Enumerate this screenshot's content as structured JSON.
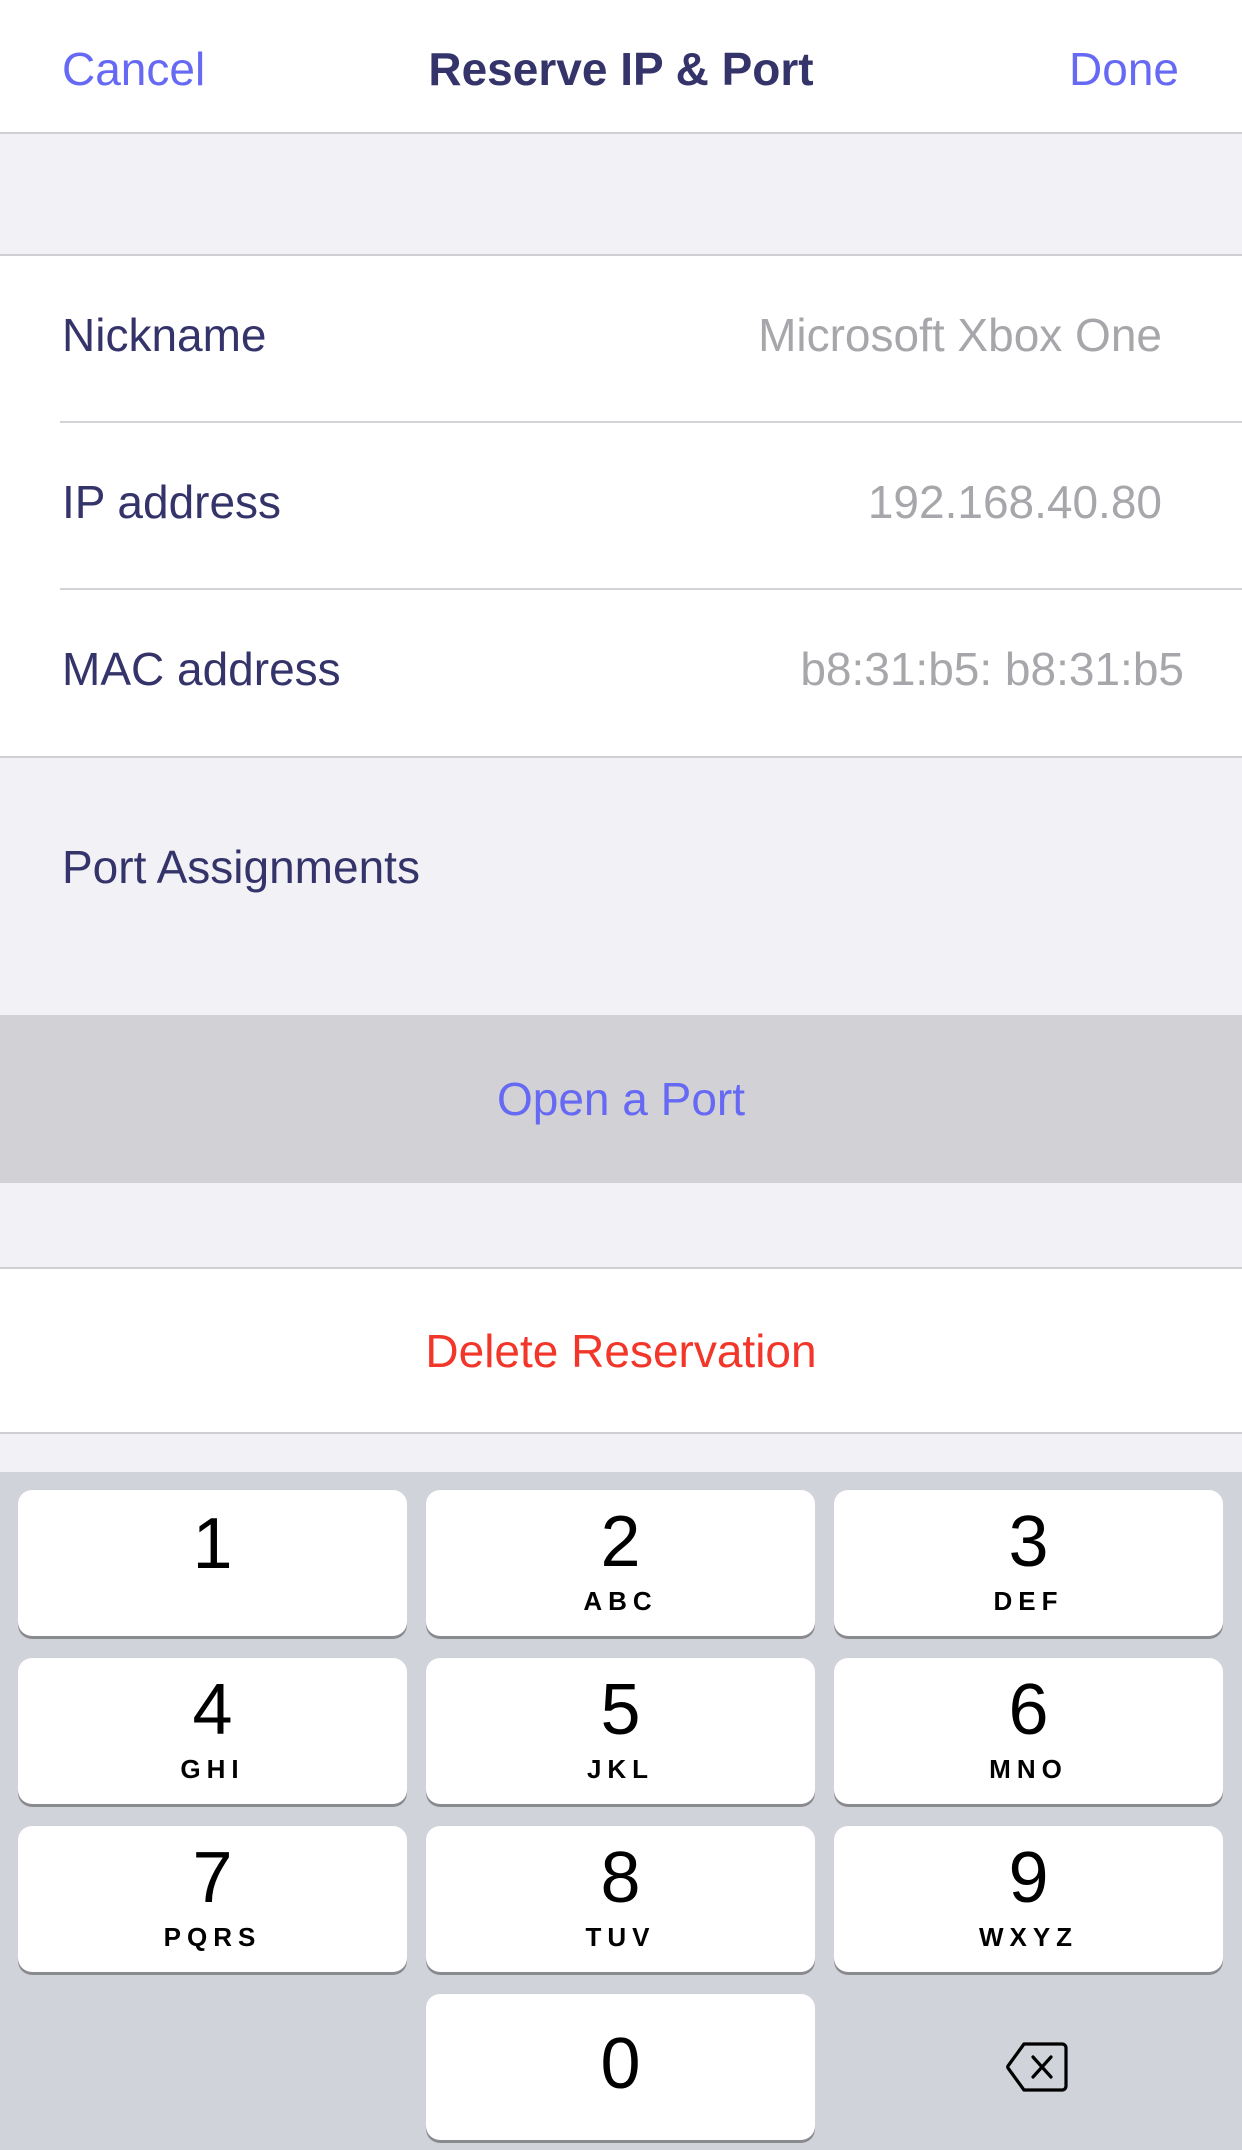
{
  "theme": {
    "accent": "#6669F3",
    "navy": "#35346A",
    "danger": "#F2362A"
  },
  "nav": {
    "cancel_label": "Cancel",
    "title": "Reserve IP & Port",
    "done_label": "Done"
  },
  "fields": {
    "nickname": {
      "label": "Nickname",
      "value": "Microsoft Xbox One"
    },
    "ip": {
      "label": "IP address",
      "value": "192.168.40.80"
    },
    "mac": {
      "label": "MAC address",
      "value": "b8:31:b5: b8:31:b5"
    }
  },
  "ports": {
    "section_title": "Port Assignments",
    "open_port_label": "Open a Port"
  },
  "delete_label": "Delete Reservation",
  "keypad": {
    "keys": [
      {
        "num": "1",
        "letters": ""
      },
      {
        "num": "2",
        "letters": "ABC"
      },
      {
        "num": "3",
        "letters": "DEF"
      },
      {
        "num": "4",
        "letters": "GHI"
      },
      {
        "num": "5",
        "letters": "JKL"
      },
      {
        "num": "6",
        "letters": "MNO"
      },
      {
        "num": "7",
        "letters": "PQRS"
      },
      {
        "num": "8",
        "letters": "TUV"
      },
      {
        "num": "9",
        "letters": "WXYZ"
      },
      {
        "num": "0",
        "letters": ""
      }
    ],
    "backspace_icon": "delete-backward-icon"
  }
}
